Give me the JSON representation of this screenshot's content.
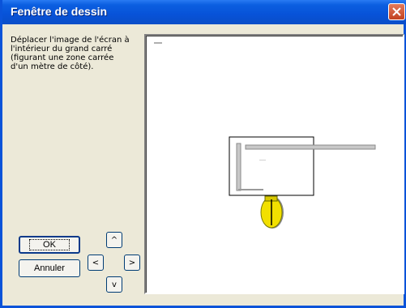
{
  "window": {
    "title": "Fenêtre de dessin"
  },
  "instructions": "Déplacer l'image de l'écran à l'intérieur du grand carré (figurant une zone carrée d'un mètre de côté).",
  "buttons": {
    "ok_label": "OK",
    "cancel_label": "Annuler",
    "up_label": "^",
    "left_label": "<",
    "right_label": ">",
    "down_label": "v"
  },
  "colors": {
    "titlebar": "#0752D8",
    "window_bg": "#ECE9D8",
    "canvas_bg": "#FFFFFF",
    "robot_body": "#F2E000"
  },
  "icons": {
    "close": "close-icon"
  }
}
